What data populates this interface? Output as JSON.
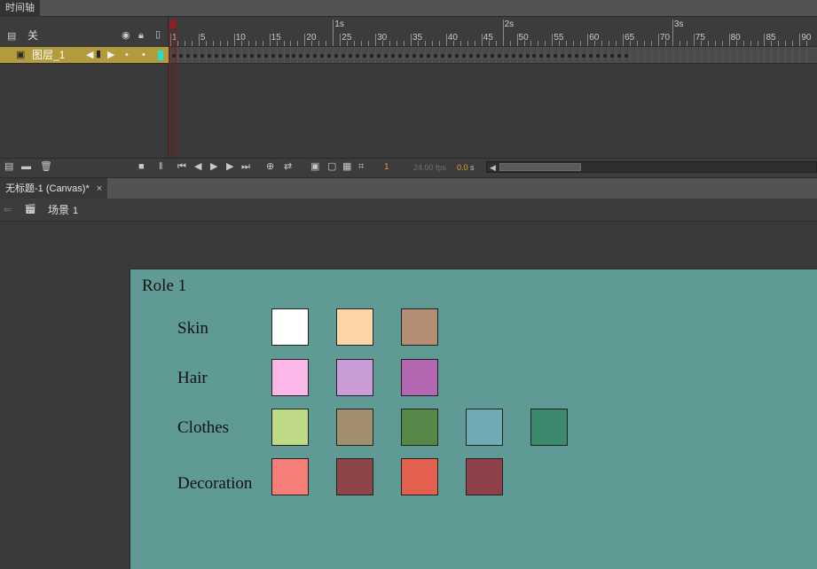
{
  "timeline": {
    "tab_label": "时间轴",
    "header": {
      "layer_label": "关"
    },
    "layer": {
      "name": "图层_1",
      "color": "#b39a3c"
    },
    "ruler": {
      "frame_numbers": [
        "1",
        "5",
        "10",
        "15",
        "20",
        "25",
        "30",
        "35",
        "40",
        "45",
        "50",
        "55",
        "60",
        "65",
        "70",
        "75",
        "80",
        "85",
        "90"
      ],
      "seconds": [
        "1s",
        "2s",
        "3s"
      ]
    },
    "toolbar": {
      "current_frame": "1",
      "fps": "24.00 fps",
      "time": "0.0",
      "time_unit": "s"
    }
  },
  "document": {
    "tab_label": "无标题-1 (Canvas)*",
    "close_glyph": "×",
    "scene_label": "场景",
    "scene_number": "1"
  },
  "canvas": {
    "background": "#5f9a94",
    "title": "Role 1",
    "rows": [
      {
        "label": "Skin",
        "swatches": [
          "#ffffff",
          "#fdd6a8",
          "#b48d75"
        ]
      },
      {
        "label": "Hair",
        "swatches": [
          "#fbb7e8",
          "#c99cd7",
          "#b367b1"
        ]
      },
      {
        "label": "Clothes",
        "swatches": [
          "#bfda86",
          "#a18e6f",
          "#568947",
          "#70aab4",
          "#3c8a6e"
        ]
      },
      {
        "label": "Decoration",
        "swatches": [
          "#f57f78",
          "#8e454a",
          "#e2604d",
          "#8e3f4a"
        ]
      }
    ]
  }
}
